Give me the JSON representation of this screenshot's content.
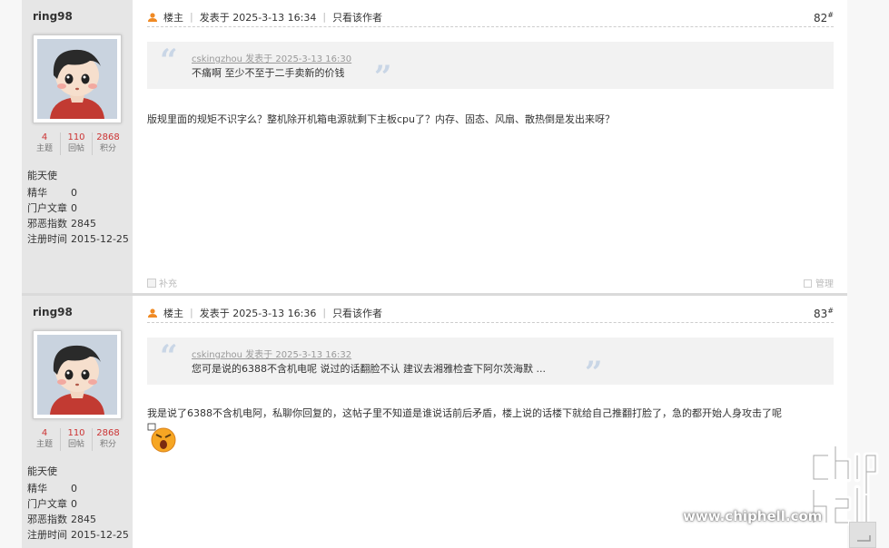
{
  "posts": [
    {
      "author": "ring98",
      "stats": [
        {
          "value": "4",
          "label": "主题"
        },
        {
          "value": "110",
          "label": "回帖"
        },
        {
          "value": "2868",
          "label": "积分"
        }
      ],
      "rank": "能天使",
      "info": [
        {
          "key": "精华",
          "value": "0"
        },
        {
          "key": "门户文章",
          "value": "0"
        },
        {
          "key": "邪恶指数",
          "value": "2845"
        },
        {
          "key": "注册时间",
          "value": "2015-12-25"
        }
      ],
      "header": {
        "role": "楼主",
        "posted": "发表于 2025-3-13 16:34",
        "only_author": "只看该作者"
      },
      "floor": "82",
      "floor_mark": "#",
      "quote": {
        "author_line": "cskingzhou 发表于 2025-3-13 16:30",
        "text": "不痛啊 至少不至于二手卖新的价钱"
      },
      "body": "版规里面的规矩不识字么？整机除开机箱电源就剩下主板cpu了？内存、固态、风扇、散热倒是发出来呀？",
      "footer": {
        "supplement": "补充",
        "manage": "管理"
      }
    },
    {
      "author": "ring98",
      "stats": [
        {
          "value": "4",
          "label": "主题"
        },
        {
          "value": "110",
          "label": "回帖"
        },
        {
          "value": "2868",
          "label": "积分"
        }
      ],
      "rank": "能天使",
      "info": [
        {
          "key": "精华",
          "value": "0"
        },
        {
          "key": "门户文章",
          "value": "0"
        },
        {
          "key": "邪恶指数",
          "value": "2845"
        },
        {
          "key": "注册时间",
          "value": "2015-12-25"
        }
      ],
      "header": {
        "role": "楼主",
        "posted": "发表于 2025-3-13 16:36",
        "only_author": "只看该作者"
      },
      "floor": "83",
      "floor_mark": "#",
      "quote": {
        "author_line": "cskingzhou 发表于 2025-3-13 16:32",
        "text": "您可是说的6388不含机电呢   说过的话翻脸不认  建议去湘雅检查下阿尔茨海默 ..."
      },
      "body": "我是说了6388不含机电阿，私聊你回复的，这帖子里不知道是谁说话前后矛盾，楼上说的话楼下就给自己推翻打脸了，急的都开始人身攻击了呢"
    }
  ],
  "watermark": {
    "url": "www.chiphell.com",
    "logo_text": "chip hell"
  },
  "quote_marks": {
    "open": "“",
    "close": "”"
  },
  "colors": {
    "stat_number": "#cc3333",
    "quote_mark": "#c9d6e6",
    "sidebar_bg": "#e6e6e6"
  },
  "icons": {
    "user": "user-icon",
    "supplement": "supplement-icon",
    "manage": "checkbox-icon",
    "emoji": "angry-emoji-icon",
    "back_to_top": "back-to-top-icon"
  }
}
